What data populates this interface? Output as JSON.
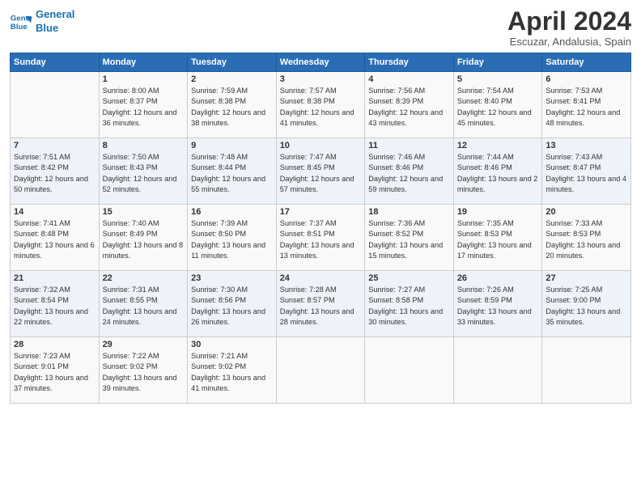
{
  "logo": {
    "line1": "General",
    "line2": "Blue"
  },
  "title": "April 2024",
  "location": "Escuzar, Andalusia, Spain",
  "days_header": [
    "Sunday",
    "Monday",
    "Tuesday",
    "Wednesday",
    "Thursday",
    "Friday",
    "Saturday"
  ],
  "weeks": [
    [
      {
        "day": "",
        "sunrise": "",
        "sunset": "",
        "daylight": ""
      },
      {
        "day": "1",
        "sunrise": "Sunrise: 8:00 AM",
        "sunset": "Sunset: 8:37 PM",
        "daylight": "Daylight: 12 hours and 36 minutes."
      },
      {
        "day": "2",
        "sunrise": "Sunrise: 7:59 AM",
        "sunset": "Sunset: 8:38 PM",
        "daylight": "Daylight: 12 hours and 38 minutes."
      },
      {
        "day": "3",
        "sunrise": "Sunrise: 7:57 AM",
        "sunset": "Sunset: 8:38 PM",
        "daylight": "Daylight: 12 hours and 41 minutes."
      },
      {
        "day": "4",
        "sunrise": "Sunrise: 7:56 AM",
        "sunset": "Sunset: 8:39 PM",
        "daylight": "Daylight: 12 hours and 43 minutes."
      },
      {
        "day": "5",
        "sunrise": "Sunrise: 7:54 AM",
        "sunset": "Sunset: 8:40 PM",
        "daylight": "Daylight: 12 hours and 45 minutes."
      },
      {
        "day": "6",
        "sunrise": "Sunrise: 7:53 AM",
        "sunset": "Sunset: 8:41 PM",
        "daylight": "Daylight: 12 hours and 48 minutes."
      }
    ],
    [
      {
        "day": "7",
        "sunrise": "Sunrise: 7:51 AM",
        "sunset": "Sunset: 8:42 PM",
        "daylight": "Daylight: 12 hours and 50 minutes."
      },
      {
        "day": "8",
        "sunrise": "Sunrise: 7:50 AM",
        "sunset": "Sunset: 8:43 PM",
        "daylight": "Daylight: 12 hours and 52 minutes."
      },
      {
        "day": "9",
        "sunrise": "Sunrise: 7:48 AM",
        "sunset": "Sunset: 8:44 PM",
        "daylight": "Daylight: 12 hours and 55 minutes."
      },
      {
        "day": "10",
        "sunrise": "Sunrise: 7:47 AM",
        "sunset": "Sunset: 8:45 PM",
        "daylight": "Daylight: 12 hours and 57 minutes."
      },
      {
        "day": "11",
        "sunrise": "Sunrise: 7:46 AM",
        "sunset": "Sunset: 8:46 PM",
        "daylight": "Daylight: 12 hours and 59 minutes."
      },
      {
        "day": "12",
        "sunrise": "Sunrise: 7:44 AM",
        "sunset": "Sunset: 8:46 PM",
        "daylight": "Daylight: 13 hours and 2 minutes."
      },
      {
        "day": "13",
        "sunrise": "Sunrise: 7:43 AM",
        "sunset": "Sunset: 8:47 PM",
        "daylight": "Daylight: 13 hours and 4 minutes."
      }
    ],
    [
      {
        "day": "14",
        "sunrise": "Sunrise: 7:41 AM",
        "sunset": "Sunset: 8:48 PM",
        "daylight": "Daylight: 13 hours and 6 minutes."
      },
      {
        "day": "15",
        "sunrise": "Sunrise: 7:40 AM",
        "sunset": "Sunset: 8:49 PM",
        "daylight": "Daylight: 13 hours and 8 minutes."
      },
      {
        "day": "16",
        "sunrise": "Sunrise: 7:39 AM",
        "sunset": "Sunset: 8:50 PM",
        "daylight": "Daylight: 13 hours and 11 minutes."
      },
      {
        "day": "17",
        "sunrise": "Sunrise: 7:37 AM",
        "sunset": "Sunset: 8:51 PM",
        "daylight": "Daylight: 13 hours and 13 minutes."
      },
      {
        "day": "18",
        "sunrise": "Sunrise: 7:36 AM",
        "sunset": "Sunset: 8:52 PM",
        "daylight": "Daylight: 13 hours and 15 minutes."
      },
      {
        "day": "19",
        "sunrise": "Sunrise: 7:35 AM",
        "sunset": "Sunset: 8:53 PM",
        "daylight": "Daylight: 13 hours and 17 minutes."
      },
      {
        "day": "20",
        "sunrise": "Sunrise: 7:33 AM",
        "sunset": "Sunset: 8:53 PM",
        "daylight": "Daylight: 13 hours and 20 minutes."
      }
    ],
    [
      {
        "day": "21",
        "sunrise": "Sunrise: 7:32 AM",
        "sunset": "Sunset: 8:54 PM",
        "daylight": "Daylight: 13 hours and 22 minutes."
      },
      {
        "day": "22",
        "sunrise": "Sunrise: 7:31 AM",
        "sunset": "Sunset: 8:55 PM",
        "daylight": "Daylight: 13 hours and 24 minutes."
      },
      {
        "day": "23",
        "sunrise": "Sunrise: 7:30 AM",
        "sunset": "Sunset: 8:56 PM",
        "daylight": "Daylight: 13 hours and 26 minutes."
      },
      {
        "day": "24",
        "sunrise": "Sunrise: 7:28 AM",
        "sunset": "Sunset: 8:57 PM",
        "daylight": "Daylight: 13 hours and 28 minutes."
      },
      {
        "day": "25",
        "sunrise": "Sunrise: 7:27 AM",
        "sunset": "Sunset: 8:58 PM",
        "daylight": "Daylight: 13 hours and 30 minutes."
      },
      {
        "day": "26",
        "sunrise": "Sunrise: 7:26 AM",
        "sunset": "Sunset: 8:59 PM",
        "daylight": "Daylight: 13 hours and 33 minutes."
      },
      {
        "day": "27",
        "sunrise": "Sunrise: 7:25 AM",
        "sunset": "Sunset: 9:00 PM",
        "daylight": "Daylight: 13 hours and 35 minutes."
      }
    ],
    [
      {
        "day": "28",
        "sunrise": "Sunrise: 7:23 AM",
        "sunset": "Sunset: 9:01 PM",
        "daylight": "Daylight: 13 hours and 37 minutes."
      },
      {
        "day": "29",
        "sunrise": "Sunrise: 7:22 AM",
        "sunset": "Sunset: 9:02 PM",
        "daylight": "Daylight: 13 hours and 39 minutes."
      },
      {
        "day": "30",
        "sunrise": "Sunrise: 7:21 AM",
        "sunset": "Sunset: 9:02 PM",
        "daylight": "Daylight: 13 hours and 41 minutes."
      },
      {
        "day": "",
        "sunrise": "",
        "sunset": "",
        "daylight": ""
      },
      {
        "day": "",
        "sunrise": "",
        "sunset": "",
        "daylight": ""
      },
      {
        "day": "",
        "sunrise": "",
        "sunset": "",
        "daylight": ""
      },
      {
        "day": "",
        "sunrise": "",
        "sunset": "",
        "daylight": ""
      }
    ]
  ]
}
